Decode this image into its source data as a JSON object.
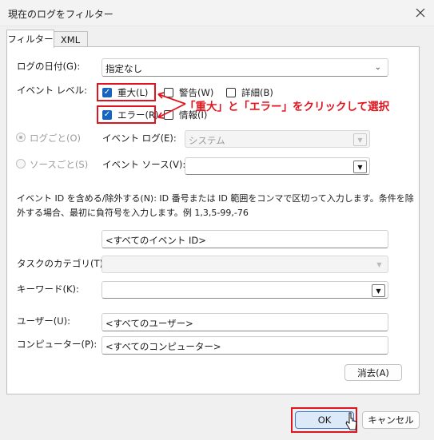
{
  "window": {
    "title": "現在のログをフィルター"
  },
  "tabs": [
    {
      "label": "フィルター"
    },
    {
      "label": "XML"
    }
  ],
  "logged": {
    "label": "ログの日付(G):",
    "value": "指定なし"
  },
  "event_level": {
    "label": "イベント レベル:",
    "critical": "重大(L)",
    "warning": "警告(W)",
    "verbose": "詳細(B)",
    "error": "エラー(R)",
    "information": "情報(I)"
  },
  "annotation": {
    "text": "「重大」と「エラー」をクリックして選択",
    "color": "#e0141e"
  },
  "by_log": {
    "radio_label": "ログごと(O)",
    "label": "イベント ログ(E):",
    "value": "システム"
  },
  "by_source": {
    "radio_label": "ソースごと(S)",
    "label": "イベント ソース(V):",
    "value": ""
  },
  "event_ids": {
    "description_line1": "イベント ID を含める/除外する(N): ID 番号または ID 範囲をコンマで区切って入力します。条件を除",
    "description_line2": "外する場合、最初に負符号を入力します。例 1,3,5-99,-76",
    "value": "<すべてのイベント ID>"
  },
  "task_category": {
    "label": "タスクのカテゴリ(T):",
    "value": ""
  },
  "keywords": {
    "label": "キーワード(K):",
    "value": ""
  },
  "user": {
    "label": "ユーザー(U):",
    "value": "<すべてのユーザー>"
  },
  "computer": {
    "label": "コンピューター(P):",
    "value": "<すべてのコンピューター>"
  },
  "buttons": {
    "clear": "消去(A)",
    "ok": "OK",
    "cancel": "キャンセル"
  },
  "icons": {
    "close": "close-icon",
    "chevron": "chevron-down-icon",
    "check": "checkmark-icon",
    "cursor": "mouse-cursor-icon"
  },
  "colors": {
    "accent": "#1565c0",
    "highlight": "#e0141e",
    "ok_button": "#dbe9f8"
  }
}
